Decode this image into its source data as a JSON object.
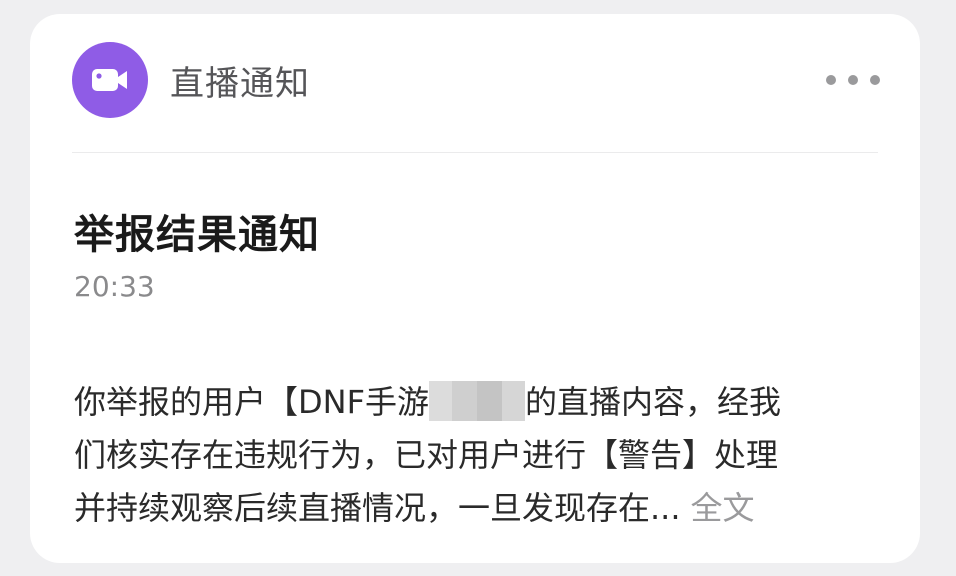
{
  "header": {
    "app_icon": "video-camera-icon",
    "app_name": "直播通知",
    "more_icon": "more-dots-icon",
    "accent_color": "#8f5ce6"
  },
  "notification": {
    "title": "举报结果通知",
    "time": "20:33",
    "body": {
      "line1_before": "你举报的用户【DNF手游",
      "line1_after": "的直播内容，经我",
      "line2": "们核实存在违规行为，已对用户进行【警告】处理",
      "line3": "并持续观察后续直播情况，一旦发现存在...",
      "expand_label": "全文"
    }
  }
}
